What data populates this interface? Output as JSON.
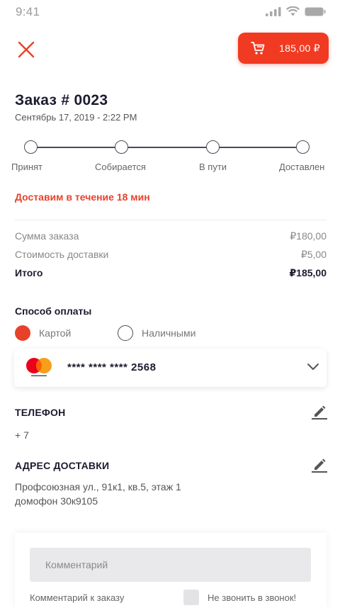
{
  "status_bar": {
    "time": "9:41"
  },
  "header": {
    "close_icon": "close-icon",
    "cart_icon": "cart-icon",
    "cart_total": "185,00 ₽"
  },
  "order": {
    "title": "Заказ # 0023",
    "date": "Сентябрь 17, 2019 - 2:22 PM"
  },
  "progress": {
    "steps": [
      "Принят",
      "Собирается",
      "В пути",
      "Доставлен"
    ]
  },
  "eta": "Доставим в течение 18 мин",
  "summary": {
    "rows": [
      {
        "label": "Сумма заказа",
        "value": "₽180,00"
      },
      {
        "label": "Стоимость доставки",
        "value": "₽5,00"
      }
    ],
    "total": {
      "label": "Итого",
      "value": "₽185,00"
    }
  },
  "payment": {
    "title": "Способ оплаты",
    "options": [
      {
        "label": "Картой",
        "selected": true
      },
      {
        "label": "Наличными",
        "selected": false
      }
    ],
    "card": {
      "brand": "mastercard",
      "masked": "**** **** ****",
      "last4": "2568"
    }
  },
  "phone": {
    "title": "ТЕЛЕФОН",
    "value": "+ 7"
  },
  "address": {
    "title": "АДРЕС ДОСТАВКИ",
    "line1": "Профсоюзная ул., 91к1, кв.5, этаж 1",
    "line2": "домофон 30к9105"
  },
  "comment": {
    "placeholder": "Комментарий",
    "label": "Комментарий к заказу",
    "no_ring_label": "Не звонить в звонок!"
  },
  "colors": {
    "accent": "#f13a22",
    "text_dark": "#1b1b30"
  }
}
